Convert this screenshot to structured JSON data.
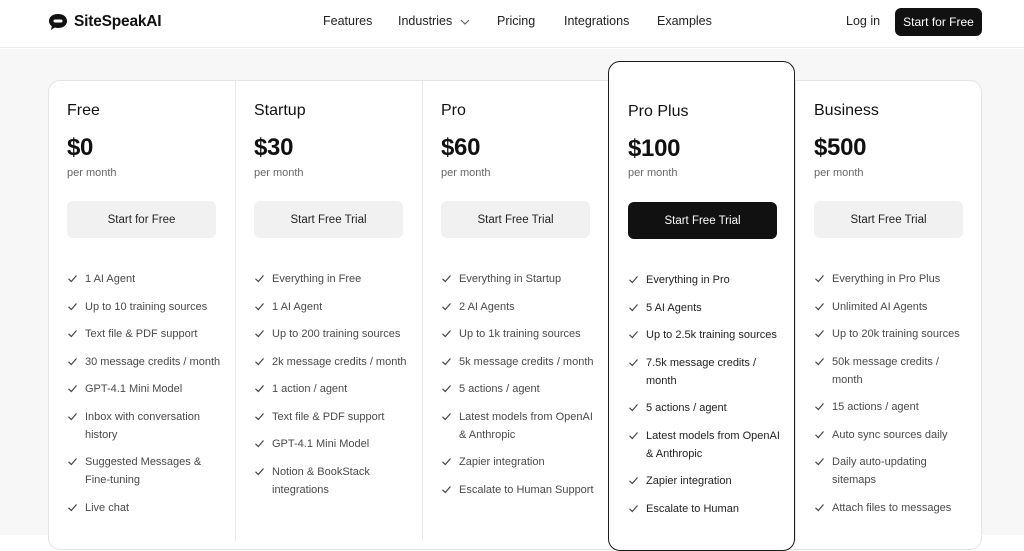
{
  "header": {
    "brand": "SiteSpeakAI",
    "nav": [
      {
        "label": "Features",
        "has_chevron": false
      },
      {
        "label": "Industries",
        "has_chevron": true
      },
      {
        "label": "Pricing",
        "has_chevron": false
      },
      {
        "label": "Integrations",
        "has_chevron": false
      },
      {
        "label": "Examples",
        "has_chevron": false
      }
    ],
    "login_label": "Log in",
    "cta_label": "Start for Free"
  },
  "colors": {
    "primary": "#111111",
    "button_light": "#f1f1f1",
    "page_bg": "#f7f7f7",
    "muted_text": "#666666"
  },
  "plans": [
    {
      "name": "Free",
      "price": "$0",
      "period": "per month",
      "button": "Start for Free",
      "featured": false,
      "features": [
        "1 AI Agent",
        "Up to 10 training sources",
        "Text file & PDF support",
        "30 message credits / month",
        "GPT-4.1 Mini Model",
        "Inbox with conversation history",
        "Suggested Messages & Fine-tuning",
        "Live chat"
      ]
    },
    {
      "name": "Startup",
      "price": "$30",
      "period": "per month",
      "button": "Start Free Trial",
      "featured": false,
      "features": [
        "Everything in Free",
        "1 AI Agent",
        "Up to 200 training sources",
        "2k message credits / month",
        "1 action / agent",
        "Text file & PDF support",
        "GPT-4.1 Mini Model",
        "Notion & BookStack integrations"
      ]
    },
    {
      "name": "Pro",
      "price": "$60",
      "period": "per month",
      "button": "Start Free Trial",
      "featured": false,
      "features": [
        "Everything in Startup",
        "2 AI Agents",
        "Up to 1k training sources",
        "5k message credits / month",
        "5 actions / agent",
        "Latest models from OpenAI & Anthropic",
        "Zapier integration",
        "Escalate to Human Support"
      ]
    },
    {
      "name": "Pro Plus",
      "price": "$100",
      "period": "per month",
      "button": "Start Free Trial",
      "featured": true,
      "features": [
        "Everything in Pro",
        "5 AI Agents",
        "Up to 2.5k training sources",
        "7.5k message credits / month",
        "5 actions / agent",
        "Latest models from OpenAI & Anthropic",
        "Zapier integration",
        "Escalate to Human"
      ]
    },
    {
      "name": "Business",
      "price": "$500",
      "period": "per month",
      "button": "Start Free Trial",
      "featured": false,
      "features": [
        "Everything in Pro Plus",
        "Unlimited AI Agents",
        "Up to 20k training sources",
        "50k message credits / month",
        "15 actions / agent",
        "Auto sync sources daily",
        "Daily auto-updating sitemaps",
        "Attach files to messages"
      ]
    }
  ]
}
